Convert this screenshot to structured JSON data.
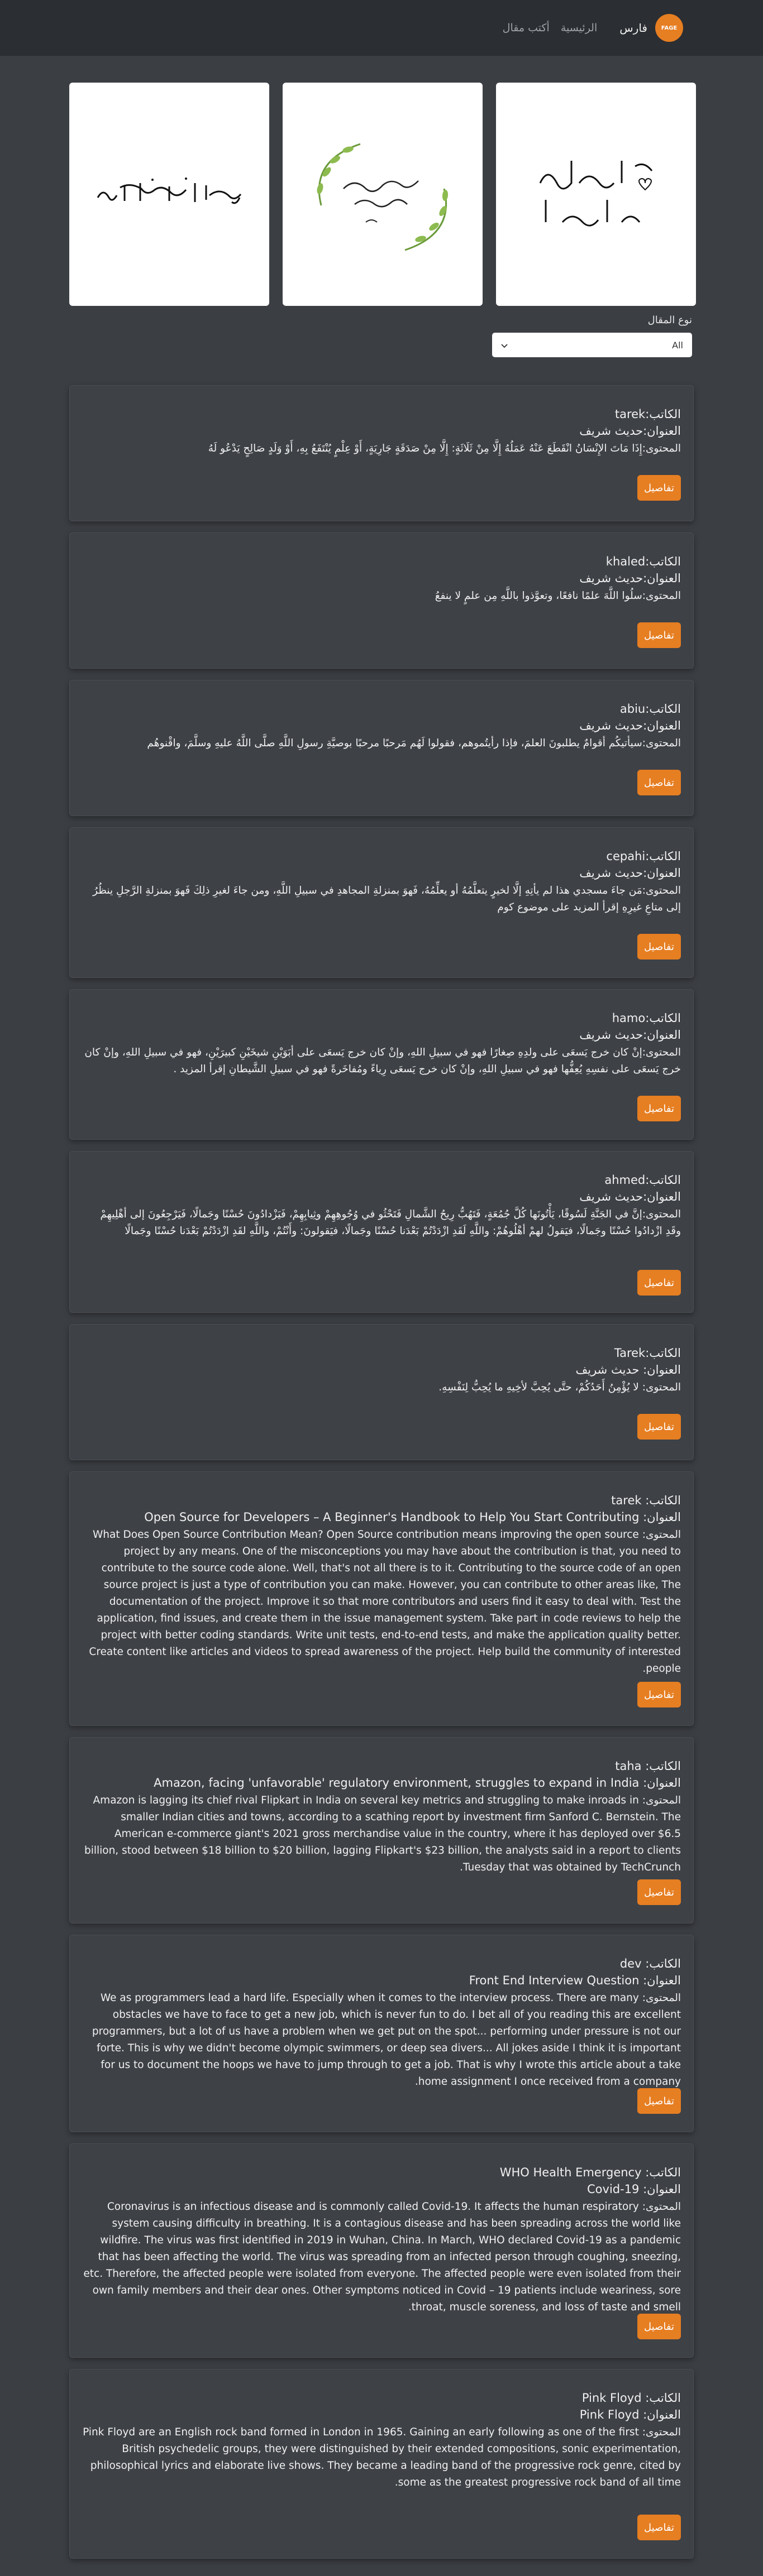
{
  "navbar": {
    "logo_text": "FAGE",
    "brand": "فارس",
    "links": [
      "الرئيسية",
      "أكتب مقال"
    ]
  },
  "filter": {
    "label": "نوع المقال",
    "selected": "All"
  },
  "cards": [
    {
      "author": "tarek",
      "title": "حديث شريف",
      "content": "إِذَا مَاتَ الإِنْسَانُ انْقَطَعَ عَنْهُ عَمَلُهُ إِلَّا مِنْ ثَلَاثَةٍ: إِلَّا مِنْ صَدَقَةٍ جَارِيَةٍ، أَوْ عِلْمٍ يُنْتَفَعُ بِهِ، أَوْ وَلَدٍ صَالِحٍ يَدْعُو لَهُ"
    },
    {
      "author": "khaled",
      "title": "حديث شريف",
      "content": "سلُوا اللَّهَ علمًا نافعًا، وتعوَّذوا باللَّهِ مِن علمٍ لا ينفعُ"
    },
    {
      "author": "abiu",
      "title": "حديث شريف",
      "content": "سيأتيكُم أقوامٌ يطلبونَ العلمَ، فإذا رأيتُموهم، فقولوا لَهُم مَرحبًا مرحبًا بوصيَّةِ رسولِ اللَّهِ صلَّى اللَّهُ عليهِ وسلَّمَ، واقْنوهُم"
    },
    {
      "author": "cepahi",
      "title": "حديث شريف",
      "content": "مَن جاءَ مسجدي هذا لم يأتِهِ إلَّا لخيرٍ يتعلَّمُهُ أو يعلِّمُهُ، فَهوَ بمنزلةِ المجاهدِ في سبيلِ اللَّهِ، ومن جاءَ لغيرِ ذلِكَ فَهوَ بمنزلةِ الرَّجلِ ينظُرُ إلى متاعِ غيرِهِ إقرأ المزيد على موضوع كوم"
    },
    {
      "author": "hamo",
      "title": "حديث شريف",
      "content": "إنْ كان خرج يَسعَى على ولدِهِ صِغارًا فهو في سبيلِ اللهِ، وإنْ كان خرج يَسعَى على أبَوَيْنِ شيخَيْنِ كبيرَيْنِ، فهو في سبيلِ اللهِ، وإنْ كان خرج يَسعَى على نفسِهِ يُعِفُّها فهو في سبيلِ اللهِ، وإنْ كان خرج يَسعَى رِياءً ومُفاخَرةً فهو في سبيلِ الشَّيطانِ إقرأ المزيد ."
    },
    {
      "author": "ahmed",
      "title": "حديث شريف",
      "content": "إنَّ في الجَنَّةِ لَسُوقًا، يَأْتُونَها كُلَّ جُمُعَةٍ، فَتَهُبُّ رِيحُ الشَّمالِ فَتَحْثُو في وُجُوهِهِمْ وثِيابِهِمْ، فَيَزْدادُونَ حُسْنًا وجَمالًا، فَيَرْجِعُونَ إلى أهْلِيهِمْ وقَدِ ازْدادُوا حُسْنًا وجَمالًا، فيَقولُ لهمْ أهْلُوهُمْ: واللَّهِ لَقَدِ ازْدَدْتُمْ بَعْدَنا حُسْنًا وجَمالًا، فيَقولونَ: وأَنْتُمْ، واللَّهِ لقَدِ ازْدَدْتُمْ بَعْدَنا حُسْنًا وجَمالًا"
    },
    {
      "author": "Tarek",
      "title": " حديث شريف",
      "content": " لا يُؤْمِنُ أَحَدُكُمْ، حتَّى يُحِبَّ لأخِيهِ ما يُحِبُّ لِنَفْسِهِ."
    },
    {
      "author": " tarek",
      "title": " Open Source for Developers – A Beginner's Handbook to Help You Start Contributing",
      "content": " What Does Open Source Contribution Mean? Open Source contribution means improving the open source project by any means. One of the misconceptions you may have about the contribution is that, you need to contribute to the source code alone. Well, that's not all there is to it. Contributing to the source code of an open source project is just a type of contribution you can make. However, you can contribute to other areas like, The documentation of the project. Improve it so that more contributors and users find it easy to deal with. Test the application, find issues, and create them in the issue management system. Take part in code reviews to help the project with better coding standards. Write unit tests, end-to-end tests, and make the application quality better. Create content like articles and videos to spread awareness of the project. Help build the community of interested people."
    },
    {
      "author": " taha",
      "title": " Amazon, facing 'unfavorable' regulatory environment, struggles to expand in India",
      "content": " Amazon is lagging its chief rival Flipkart in India on several key metrics and struggling to make inroads in smaller Indian cities and towns, according to a scathing report by investment firm Sanford C. Bernstein. The American e-commerce giant's 2021 gross merchandise value in the country, where it has deployed over $6.5 billion, stood between $18 billion to $20 billion, lagging Flipkart's $23 billion, the analysts said in a report to clients Tuesday that was obtained by TechCrunch."
    },
    {
      "author": " dev",
      "title": " Front End Interview Question",
      "content": " We as programmers lead a hard life. Especially when it comes to the interview process. There are many obstacles we have to face to get a new job, which is never fun to do. I bet all of you reading this are excellent programmers, but a lot of us have a problem when we get put on the spot... performing under pressure is not our forte. This is why we didn't become olympic swimmers, or deep sea divers... All jokes aside I think it is important for us to document the hoops we have to jump through to get a job. That is why I wrote this article about a take home assignment I once received from a company."
    },
    {
      "author": " WHO Health Emergency",
      "title": " Covid-19",
      "content": " Coronavirus is an infectious disease and is commonly called Covid-19. It affects the human respiratory system causing difficulty in breathing. It is a contagious disease and has been spreading across the world like wildfire. The virus was first identified in 2019 in Wuhan, China. In March, WHO declared Covid-19 as a pandemic that has been affecting the world. The virus was spreading from an infected person through coughing, sneezing, etc. Therefore, the affected people were isolated from everyone. The affected people were even isolated from their own family members and their dear ones. Other symptoms noticed in Covid – 19 patients include weariness, sore throat, muscle soreness, and loss of taste and smell."
    },
    {
      "author": " Pink Floyd",
      "title": " Pink Floyd",
      "content": " Pink Floyd are an English rock band formed in London in 1965. Gaining an early following as one of the first British psychedelic groups, they were distinguished by their extended compositions, sonic experimentation, philosophical lyrics and elaborate live shows. They became a leading band of the progressive rock genre, cited by some as the greatest progressive rock band of all time."
    }
  ],
  "labels": {
    "author": "الكاتب:",
    "title": "العنوان:",
    "content": "المحتوى:",
    "details": "تفاصيل"
  }
}
